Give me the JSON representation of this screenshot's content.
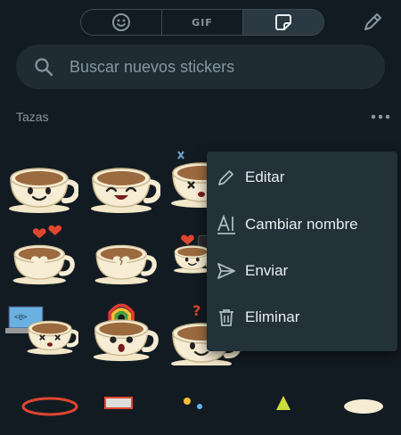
{
  "tabs": [
    {
      "id": "emoji",
      "icon": "emoji-icon"
    },
    {
      "id": "gif",
      "label": "GIF"
    },
    {
      "id": "stickers",
      "icon": "sticker-icon",
      "active": true
    }
  ],
  "search": {
    "placeholder": "Buscar nuevos stickers"
  },
  "pack": {
    "title": "Tazas"
  },
  "menu": {
    "items": [
      {
        "label": "Editar",
        "icon": "pencil-icon"
      },
      {
        "label": "Cambiar nombre",
        "icon": "rename-icon"
      },
      {
        "label": "Enviar",
        "icon": "send-icon"
      },
      {
        "label": "Eliminar",
        "icon": "trash-icon"
      }
    ]
  },
  "colors": {
    "background": "#121b22",
    "surface": "#202c33",
    "menu": "#233138",
    "muted": "#8696a0",
    "text": "#e9edef"
  }
}
